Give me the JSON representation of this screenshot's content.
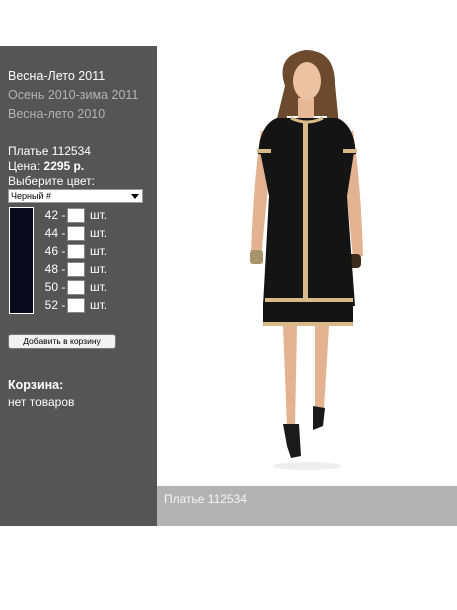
{
  "seasons": [
    {
      "label": "Весна-Лето 2011",
      "active": true
    },
    {
      "label": "Осень 2010-зима 2011",
      "active": false
    },
    {
      "label": "Весна-лето 2010",
      "active": false
    }
  ],
  "product": {
    "name": "Платье 112534",
    "price_label": "Цена:",
    "price_value": "2295 р.",
    "choose_color_label": "Выберите цвет:",
    "selected_color": "Черный #",
    "swatch_color": "#0a0a1c"
  },
  "sizes": [
    {
      "size": "42",
      "unit": "шт."
    },
    {
      "size": "44",
      "unit": "шт."
    },
    {
      "size": "46",
      "unit": "шт."
    },
    {
      "size": "48",
      "unit": "шт."
    },
    {
      "size": "50",
      "unit": "шт."
    },
    {
      "size": "52",
      "unit": "шт."
    }
  ],
  "add_to_cart_label": "Добавить в корзину",
  "cart": {
    "title": "Корзина:",
    "status": "нет товаров"
  },
  "caption": "Платье 112534",
  "colors": {
    "sidebar_bg": "#555555",
    "caption_bg": "#b3b3b3",
    "dress": "#141414",
    "trim": "#d8b98a"
  }
}
